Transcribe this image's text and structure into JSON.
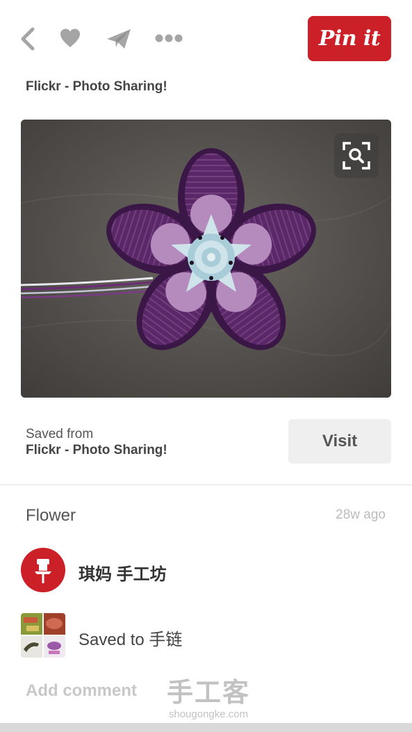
{
  "toolbar": {
    "icons": [
      "back-icon",
      "heart-icon",
      "send-icon",
      "more-icon"
    ],
    "pin_it_label": "Pin it"
  },
  "pin": {
    "source_title": "Flickr - Photo Sharing!",
    "image": {
      "subject": "purple macrame knotted flower",
      "zoom_icon": "zoom-search-icon"
    },
    "saved_from_label": "Saved from",
    "saved_from_name": "Flickr - Photo Sharing!",
    "visit_label": "Visit",
    "description": "Flower",
    "time_ago": "28w ago"
  },
  "pinner": {
    "name": "琪妈 手工坊",
    "avatar_icon": "pushpin-icon"
  },
  "board": {
    "saved_to_text": "Saved to 手链"
  },
  "comment": {
    "add_comment_label": "Add comment"
  },
  "watermark": {
    "text": "手工客",
    "url": "shougongke.com"
  },
  "colors": {
    "brand_red": "#cb2027",
    "icon_gray": "#a5a5a5",
    "button_gray": "#efefef"
  }
}
